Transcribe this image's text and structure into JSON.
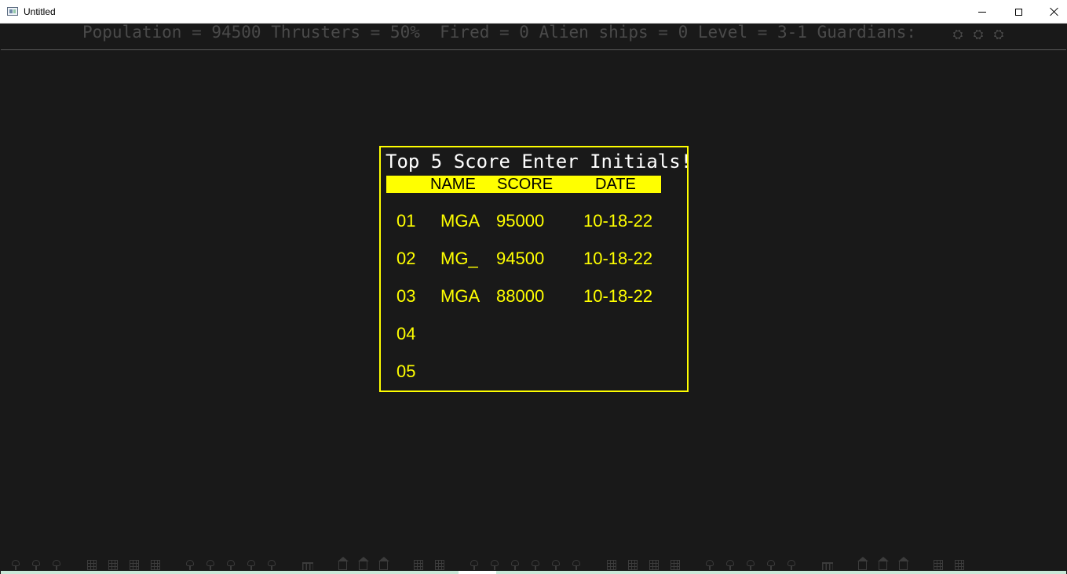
{
  "window": {
    "title": "Untitled",
    "icon": "app-window-icon",
    "controls": {
      "minimize": "minimize-icon",
      "maximize": "maximize-icon",
      "close": "close-icon"
    }
  },
  "hud": {
    "status_text": "Population = 94500 Thrusters = 50%  Fired = 0 Alien ships = 0 Level = 3-1 Guardians:",
    "guardian_icons": [
      "gear-icon",
      "gear-icon",
      "gear-icon"
    ],
    "color": "#4a4a4a"
  },
  "score_panel": {
    "title": "Top 5 Score Enter Initials!",
    "headers": {
      "name": "NAME",
      "score": "SCORE",
      "date": "DATE"
    },
    "rows": [
      {
        "rank": "01",
        "name": "MGA",
        "score": "95000",
        "date": "10-18-22"
      },
      {
        "rank": "02",
        "name": "MG_",
        "score": "94500",
        "date": "10-18-22"
      },
      {
        "rank": "03",
        "name": "MGA",
        "score": "88000",
        "date": "10-18-22"
      },
      {
        "rank": "04",
        "name": "",
        "score": "",
        "date": ""
      },
      {
        "rank": "05",
        "name": "",
        "score": "",
        "date": ""
      }
    ],
    "accent_color": "#ffff00",
    "title_color": "#ffffff"
  },
  "skyline": {
    "buildings": [
      "tree",
      "tree",
      "tree",
      "tower",
      "tower",
      "tower",
      "tower",
      "tree",
      "tree",
      "tree",
      "tree",
      "tree",
      "temple",
      "house",
      "house",
      "house",
      "tower",
      "tower",
      "tree",
      "tree",
      "tree",
      "tree",
      "tree",
      "tree",
      "tower",
      "tower",
      "tower",
      "tower",
      "tree",
      "tree",
      "tree",
      "tree",
      "tree",
      "temple",
      "house",
      "house",
      "house",
      "tower",
      "tower"
    ],
    "color": "#3c3c3c"
  },
  "colors": {
    "background": "#191919",
    "ground": "#c8e8d8"
  }
}
